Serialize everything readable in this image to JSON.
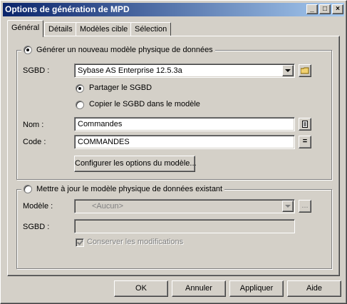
{
  "window": {
    "title": "Options de génération de MPD",
    "minimize_glyph": "_",
    "maximize_glyph": "□",
    "close_glyph": "×"
  },
  "tabs": [
    {
      "label": "Général",
      "active": true
    },
    {
      "label": "Détails",
      "active": false
    },
    {
      "label": "Modèles cible",
      "active": false
    },
    {
      "label": "Sélection",
      "active": false
    }
  ],
  "generate_group": {
    "radio_label": "Générer un nouveau modèle physique de données",
    "selected": true,
    "sgbd_label": "SGBD :",
    "sgbd_value": "Sybase AS Enterprise 12.5.3a",
    "share_label": "Partager le SGBD",
    "share_selected": true,
    "copy_label": "Copier le SGBD dans le modèle",
    "copy_selected": false,
    "name_label": "Nom :",
    "name_value": "Commandes",
    "code_label": "Code :",
    "code_value": "COMMANDES",
    "code_button_glyph": "=",
    "configure_button": "Configurer les options du modèle..."
  },
  "update_group": {
    "radio_label": "Mettre à jour le modèle physique de données existant",
    "selected": false,
    "model_label": "Modèle :",
    "model_value": "<Aucun>",
    "browse_button": "...",
    "sgbd_label": "SGBD :",
    "sgbd_value": "",
    "keep_changes_label": "Conserver les modifications",
    "keep_changes_checked": true
  },
  "buttons": {
    "ok": "OK",
    "cancel": "Annuler",
    "apply": "Appliquer",
    "help": "Aide"
  },
  "icons": {
    "folder": "folder-icon",
    "properties": "properties-icon"
  },
  "colors": {
    "titlebar_start": "#0a246a",
    "titlebar_end": "#a6caf0",
    "face": "#d4d0c8"
  }
}
